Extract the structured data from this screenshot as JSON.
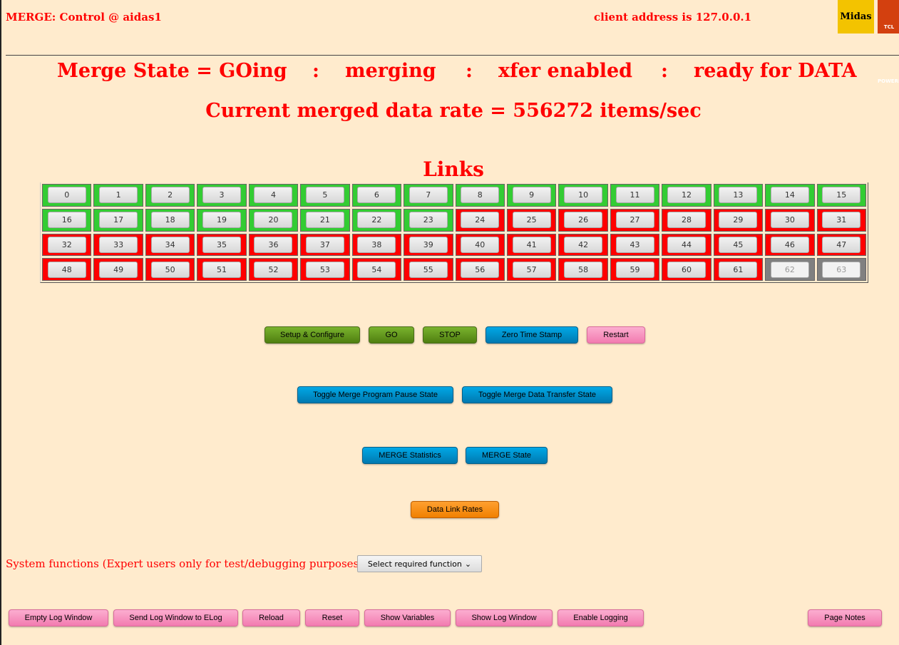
{
  "header": {
    "title": "MERGE: Control @ aidas1",
    "client": "client address is 127.0.0.1",
    "logo_midas": "Midas",
    "logo_tcl": "TCL POWERED"
  },
  "state": {
    "items": [
      "Merge State = GOing",
      ":",
      "merging",
      ":",
      "xfer enabled",
      ":",
      "ready for DATA"
    ]
  },
  "rate": "Current merged data rate = 556272 items/sec",
  "links": {
    "title": "Links",
    "colors": {
      "green": "#33cc33",
      "red": "#ff0000",
      "grey": "#808080"
    },
    "status": [
      "green",
      "green",
      "green",
      "green",
      "green",
      "green",
      "green",
      "green",
      "green",
      "green",
      "green",
      "green",
      "green",
      "green",
      "green",
      "green",
      "green",
      "green",
      "green",
      "green",
      "green",
      "green",
      "green",
      "green",
      "red",
      "red",
      "red",
      "red",
      "red",
      "red",
      "red",
      "red",
      "red",
      "red",
      "red",
      "red",
      "red",
      "red",
      "red",
      "red",
      "red",
      "red",
      "red",
      "red",
      "red",
      "red",
      "red",
      "red",
      "red",
      "red",
      "red",
      "red",
      "red",
      "red",
      "red",
      "red",
      "red",
      "red",
      "red",
      "red",
      "red",
      "red",
      "grey",
      "grey"
    ]
  },
  "buttons": {
    "setup": "Setup & Configure",
    "go": "GO",
    "stop": "STOP",
    "zero": "Zero Time Stamp",
    "restart": "Restart",
    "pause": "Toggle Merge Program Pause State",
    "xfer": "Toggle Merge Data Transfer State",
    "stats": "MERGE Statistics",
    "mstate": "MERGE State",
    "rates": "Data Link Rates"
  },
  "system": {
    "label": "System functions (Expert users only for test/debugging purposes!!!)",
    "select": "Select required function"
  },
  "footer": {
    "empty": "Empty Log Window",
    "send": "Send Log Window to ELog",
    "reload": "Reload",
    "reset": "Reset",
    "vars": "Show Variables",
    "showlog": "Show Log Window",
    "enable": "Enable Logging",
    "notes": "Page Notes"
  }
}
